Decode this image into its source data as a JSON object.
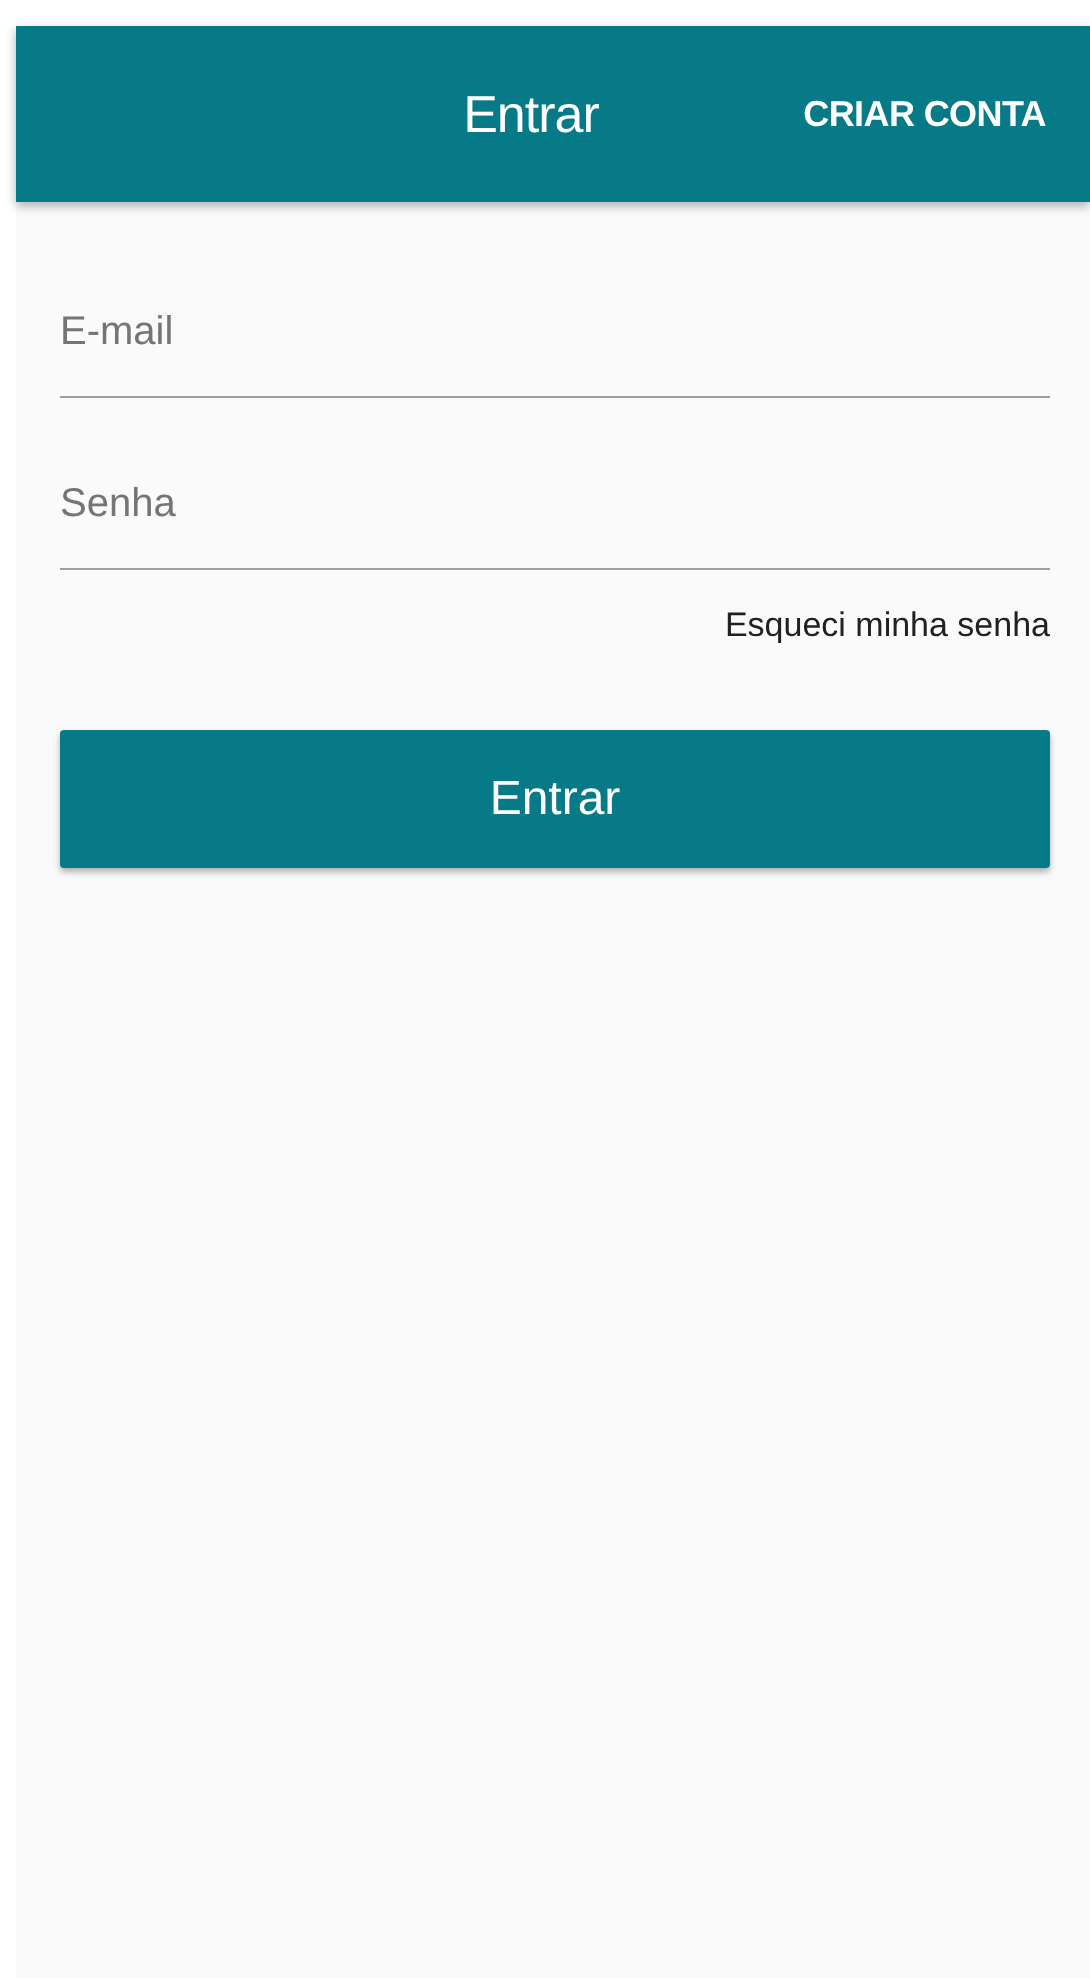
{
  "app_bar": {
    "title": "Entrar",
    "action": "CRIAR CONTA"
  },
  "fields": [
    {
      "placeholder": "E-mail"
    },
    {
      "placeholder": "Senha"
    }
  ],
  "forgot_link": "Esqueci minha senha",
  "submit_button": "Entrar"
}
